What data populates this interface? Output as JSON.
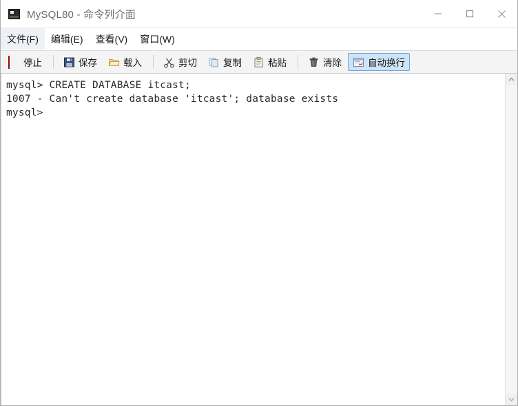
{
  "window": {
    "title": "MySQL80 - 命令列介面",
    "icon": "console-icon",
    "controls": {
      "minimize": "minimize-icon",
      "maximize": "maximize-icon",
      "close": "close-icon"
    }
  },
  "menubar": {
    "items": [
      {
        "label": "文件(F)",
        "name": "menu-file",
        "active": true
      },
      {
        "label": "编辑(E)",
        "name": "menu-edit",
        "active": false
      },
      {
        "label": "查看(V)",
        "name": "menu-view",
        "active": false
      },
      {
        "label": "窗口(W)",
        "name": "menu-window",
        "active": false
      }
    ]
  },
  "toolbar": {
    "stop_label": "停止",
    "save_label": "保存",
    "load_label": "载入",
    "cut_label": "剪切",
    "copy_label": "复制",
    "paste_label": "粘贴",
    "clear_label": "清除",
    "wordwrap_label": "自动换行",
    "wordwrap_active": true,
    "icons": {
      "stop": "stop-square-icon",
      "save": "floppy-disk-icon",
      "load": "folder-open-icon",
      "cut": "scissors-icon",
      "copy": "copy-pages-icon",
      "paste": "clipboard-icon",
      "clear": "trash-can-icon",
      "wordwrap": "word-wrap-icon"
    }
  },
  "terminal": {
    "lines": [
      "mysql> CREATE DATABASE itcast;",
      "1007 - Can't create database 'itcast'; database exists",
      "mysql>"
    ]
  },
  "scrollbar": {
    "up": "chevron-up-icon",
    "down": "chevron-down-icon"
  },
  "colors": {
    "accent": "#cfe3f7",
    "accent_border": "#6ca6dd",
    "stop_red": "#e81212",
    "toolbar_bg": "#f4f4f4",
    "title_text": "#6b6b6b"
  }
}
